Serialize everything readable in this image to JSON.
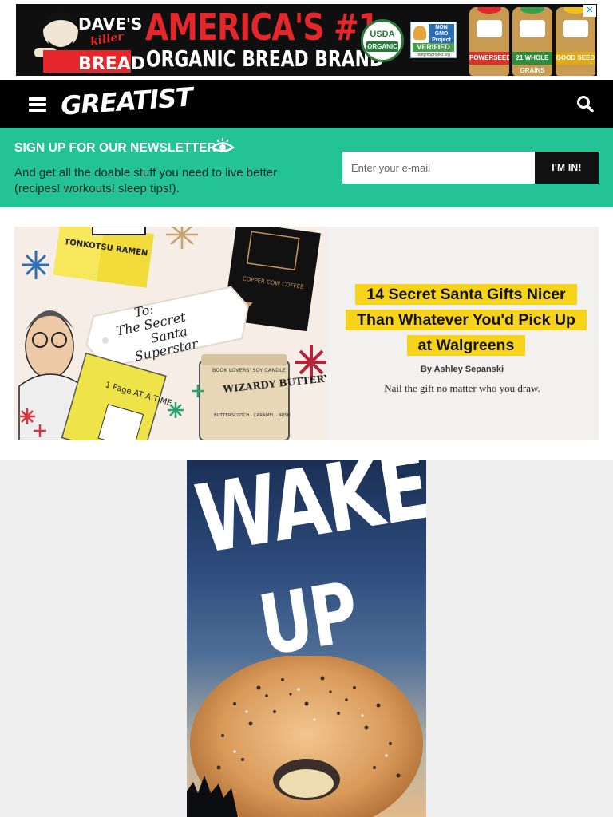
{
  "top_ad": {
    "brand_line1": "DAVE'S",
    "brand_line2": "killer",
    "brand_line3": "BREAD",
    "headline": "AMERICA'S #1",
    "subline": "ORGANIC BREAD BRAND",
    "usda_line1": "USDA",
    "usda_line2": "ORGANIC",
    "nongmo_line1": "NON GMO Project",
    "nongmo_line2": "VERIFIED",
    "nongmo_line3": "nongmoproject.org",
    "bag_labels": [
      "POWERSEED",
      "21 WHOLE GRAINS",
      "GOOD SEED"
    ],
    "ad_choice": "✕"
  },
  "header": {
    "logo": "GREATIST",
    "menu_icon": "hamburger-menu-icon",
    "search_icon": "search-icon"
  },
  "newsletter": {
    "title": "SIGN UP FOR OUR NEWSLETTER",
    "description": "And get all the doable stuff you need to live better (recipes! workouts! sleep tips!).",
    "email_placeholder": "Enter your e-mail",
    "button_label": "I'M IN!",
    "accent": "#24c395"
  },
  "featured": {
    "headline_lines": [
      "14 Secret Santa Gifts Nicer",
      "Than Whatever You'd Pick Up",
      "at Walgreens"
    ],
    "byline": "By Ashley Sepanski",
    "description": "Nail the gift no matter who you draw.",
    "image_tag_text": [
      "To:",
      "The Secret",
      "Santa",
      "Superstar"
    ],
    "image_items": [
      "TONKOTSU RAMEN",
      "COPPER COW COFFEE",
      "BOOK LOVERS' SOY CANDLE",
      "WIZARDY BUTTERY DRINK",
      "BUTTERSCOTCH · CARAMEL · IRISH",
      "1 Page AT A TIME"
    ],
    "highlight_color": "#f7d419"
  },
  "bottom_ad": {
    "line1": "WAKE",
    "line2": "UP"
  }
}
